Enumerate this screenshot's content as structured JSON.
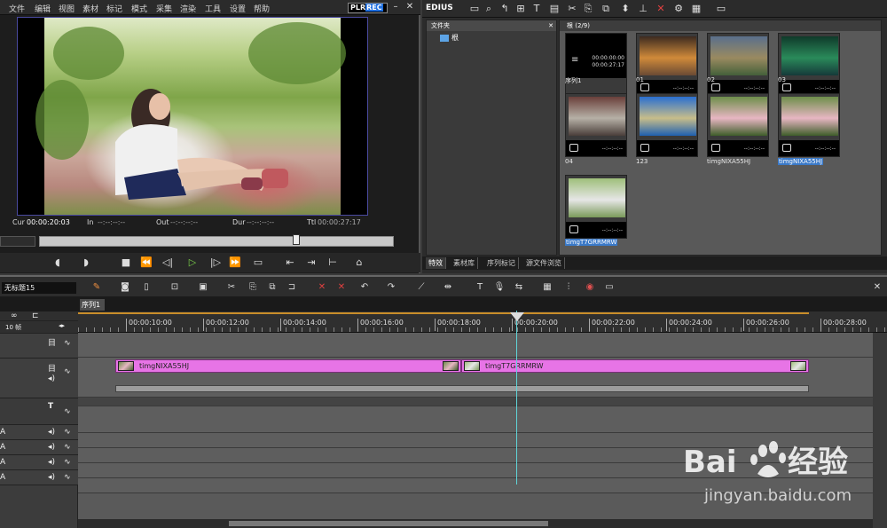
{
  "menu": [
    "文件",
    "编辑",
    "视图",
    "素材",
    "标记",
    "模式",
    "采集",
    "渲染",
    "工具",
    "设置",
    "帮助"
  ],
  "player": {
    "mode_plr": "PLR",
    "mode_rec": "REC",
    "cur_label": "Cur",
    "cur_value": "00:00:20:03",
    "in_label": "In",
    "in_value": "--:--:--:--",
    "out_label": "Out",
    "out_value": "--:--:--:--",
    "dur_label": "Dur",
    "dur_value": "--:--:--:--",
    "ttl_label": "Ttl",
    "ttl_value": "00:00:27:17",
    "scrub_position": 0.72
  },
  "bin": {
    "title": "EDIUS",
    "folder_header": "文件夹",
    "folder_root": "根",
    "clip_header": "根 (2/9)",
    "clips": [
      {
        "label": "序列1",
        "kind": "sequence",
        "tc1": "00:00:00:00",
        "tc2": "00:00:27:17",
        "selected": false
      },
      {
        "label": "01",
        "kind": "image",
        "dur": "--:--:--:--",
        "colors": [
          "#3c2a20",
          "#d08a3a",
          "#6a4a34"
        ],
        "selected": false
      },
      {
        "label": "02",
        "kind": "image",
        "dur": "--:--:--:--",
        "colors": [
          "#5a6f8c",
          "#9a8a60",
          "#44603a"
        ],
        "selected": false
      },
      {
        "label": "03",
        "kind": "image",
        "dur": "--:--:--:--",
        "colors": [
          "#0f3a2a",
          "#2a8a5a",
          "#163a3a"
        ],
        "selected": false
      },
      {
        "label": "04",
        "kind": "image",
        "dur": "--:--:--:--",
        "colors": [
          "#6a3f3a",
          "#b6b0a6",
          "#4a3e3a"
        ],
        "selected": false
      },
      {
        "label": "123",
        "kind": "image",
        "dur": "--:--:--:--",
        "colors": [
          "#2a6fd0",
          "#c7bd8a",
          "#1f60b0"
        ],
        "selected": false
      },
      {
        "label": "timgNIXA55HJ",
        "kind": "image",
        "dur": "--:--:--:--",
        "colors": [
          "#6d8e4a",
          "#e7b6c2",
          "#3f5e2a"
        ],
        "selected": false
      },
      {
        "label": "timgNIXA55HJ",
        "kind": "image",
        "dur": "--:--:--:--",
        "colors": [
          "#6d8e4a",
          "#e7b6c2",
          "#3f5e2a"
        ],
        "selected": true
      },
      {
        "label": "timgT7GRRMRW",
        "kind": "image",
        "dur": "--:--:--:--",
        "colors": [
          "#9fbf7a",
          "#e6e6e6",
          "#7a9a5a"
        ],
        "selected": true
      }
    ],
    "tabs": [
      "特效",
      "素材库",
      "序列标记",
      "源文件浏览"
    ]
  },
  "timeline": {
    "project_name": "无标题15",
    "sequence_tab": "序列1",
    "zoom_label": "10 帧",
    "ruler": [
      "00:00:10:00",
      "00:00:12:00",
      "00:00:14:00",
      "00:00:16:00",
      "00:00:18:00",
      "00:00:20:00",
      "00:00:22:00",
      "00:00:24:00",
      "00:00:26:00",
      "00:00:28:00"
    ],
    "clips": [
      {
        "name": "timgNIXA55HJ"
      },
      {
        "name": "timgT7GRRMRW"
      }
    ],
    "track_labels": {
      "title": "T",
      "audio": "A"
    }
  },
  "watermark": {
    "brand": "Bai du 经验",
    "url": "jingyan.baidu.com"
  }
}
